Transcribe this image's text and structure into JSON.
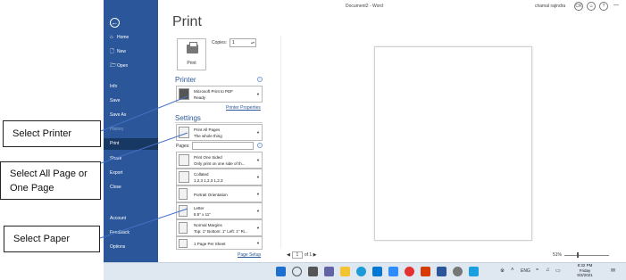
{
  "titlebar": {
    "doc_title": "Document2 - Word",
    "user": "chamal rajindra",
    "user_initials": "CR"
  },
  "sidebar": {
    "back_icon": "back-arrow-icon",
    "items": [
      {
        "label": "Home",
        "icon": "⌂"
      },
      {
        "label": "New",
        "icon": "🗋"
      },
      {
        "label": "Open",
        "icon": "🗁"
      },
      {
        "label": "Info",
        "icon": ""
      },
      {
        "label": "Save",
        "icon": ""
      },
      {
        "label": "Save As",
        "icon": ""
      },
      {
        "label": "History",
        "icon": ""
      },
      {
        "label": "Print",
        "icon": ""
      },
      {
        "label": "Share",
        "icon": ""
      },
      {
        "label": "Export",
        "icon": ""
      },
      {
        "label": "Close",
        "icon": ""
      },
      {
        "label": "Account",
        "icon": ""
      },
      {
        "label": "Feedback",
        "icon": ""
      },
      {
        "label": "Options",
        "icon": ""
      }
    ]
  },
  "print": {
    "heading": "Print",
    "button_label": "Print",
    "copies_label": "Copies:",
    "copies_value": "1",
    "printer_section": "Printer",
    "printer_name": "Microsoft Print to PDF",
    "printer_status": "Ready",
    "printer_properties": "Printer Properties",
    "settings_section": "Settings",
    "settings": [
      {
        "line1": "Print All Pages",
        "line2": "The whole thing"
      },
      {
        "line1": "Print One Sided",
        "line2": "Only print on one side of th..."
      },
      {
        "line1": "Collated",
        "line2": "1,2,3    1,2,3    1,2,3"
      },
      {
        "line1": "Portrait Orientation",
        "line2": ""
      },
      {
        "line1": "Letter",
        "line2": "8.5\" x 11\""
      },
      {
        "line1": "Normal Margins",
        "line2": "Top: 1\" Bottom: 1\" Left: 1\" Ri..."
      },
      {
        "line1": "1 Page Per Sheet",
        "line2": ""
      }
    ],
    "pages_label": "Pages:",
    "pages_value": "",
    "page_setup": "Page Setup"
  },
  "preview": {
    "current_page": "1",
    "of_pages": "of 1",
    "zoom": "51%"
  },
  "taskbar": {
    "time": "8:32 PM",
    "day": "Friday",
    "date": "9/3/2021",
    "lang": "ENG"
  },
  "callouts": {
    "printer": "Select Printer",
    "pages": "Select All Page or One Page",
    "paper": "Select Paper"
  }
}
